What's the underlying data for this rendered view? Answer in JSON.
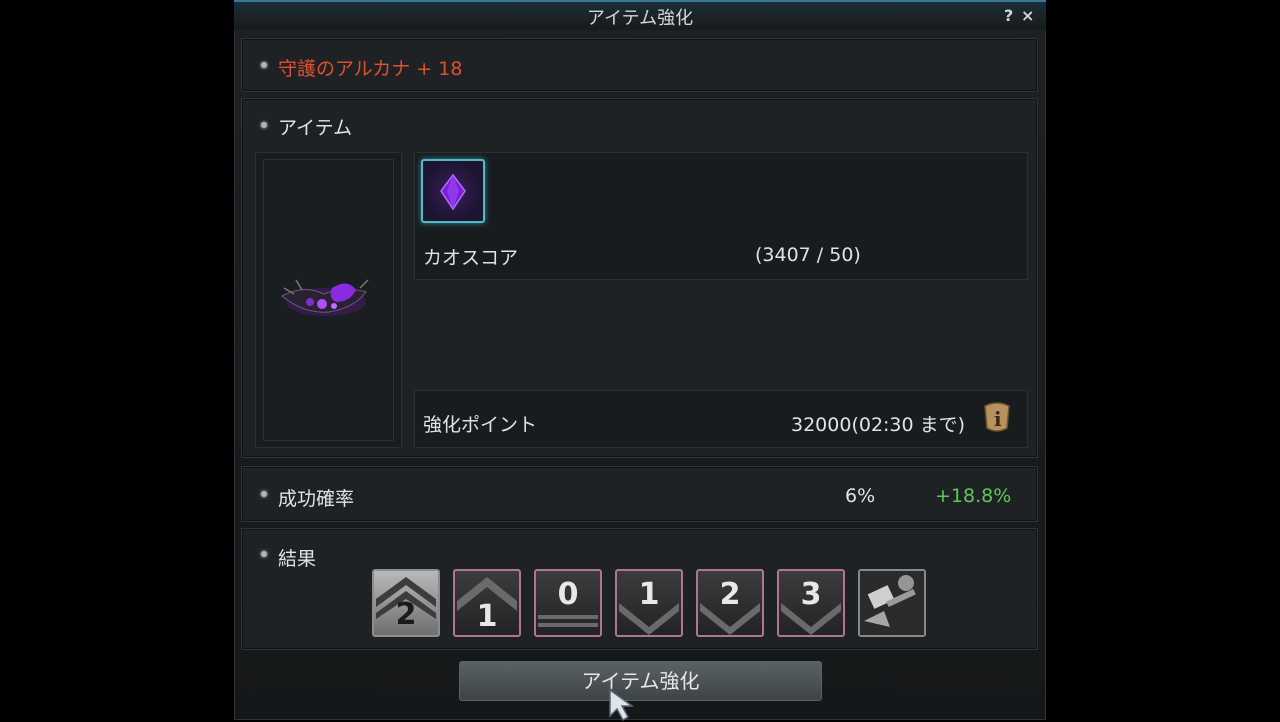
{
  "window": {
    "title": "アイテム強化",
    "help_label": "?",
    "close_label": "×"
  },
  "target": {
    "name": "守護のアルカナ + 18"
  },
  "item_section": {
    "heading": "アイテム",
    "material_name": "カオスコア",
    "material_count": "(3407 / 50)",
    "points_label": "強化ポイント",
    "points_value": "32000(02:30 まで)"
  },
  "success": {
    "label": "成功確率",
    "rate": "6%",
    "bonus": "+18.8%"
  },
  "result": {
    "heading": "結果",
    "outcomes": [
      {
        "label": "2",
        "kind": "up-double",
        "color": "silver"
      },
      {
        "label": "1",
        "kind": "up",
        "color": "dark"
      },
      {
        "label": "0",
        "kind": "stay",
        "color": "dark"
      },
      {
        "label": "1",
        "kind": "down",
        "color": "dark"
      },
      {
        "label": "2",
        "kind": "down",
        "color": "dark"
      },
      {
        "label": "3",
        "kind": "down",
        "color": "dark"
      },
      {
        "label": "",
        "kind": "hammer",
        "color": "silver"
      }
    ]
  },
  "action": {
    "button_label": "アイテム強化"
  },
  "colors": {
    "item_name": "#e0502c",
    "bonus": "#5fc75a",
    "slot_border": "#56b8c4",
    "result_border": "#b0758f"
  }
}
